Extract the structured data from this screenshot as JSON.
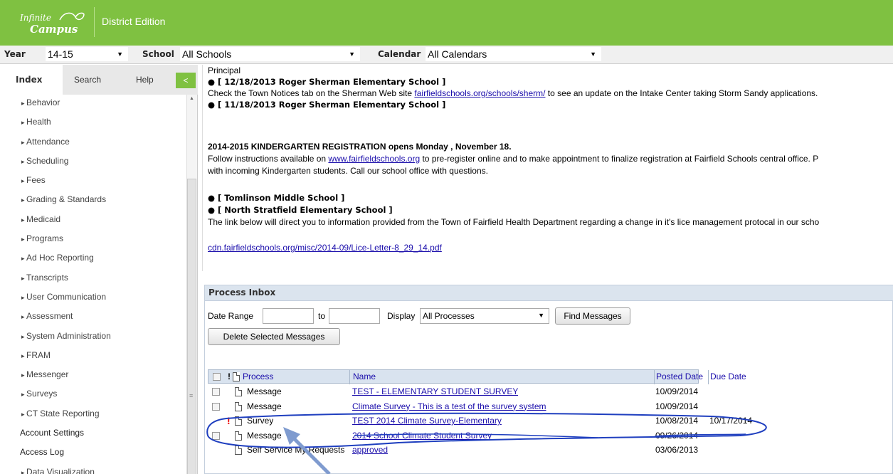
{
  "header": {
    "logo_line1": "Infinite",
    "logo_line2": "Campus",
    "edition": "District Edition",
    "accent_color": "#7fc141"
  },
  "filters": {
    "year_label": "Year",
    "year_value": "14-15",
    "school_label": "School",
    "school_value": "All Schools",
    "calendar_label": "Calendar",
    "calendar_value": "All Calendars"
  },
  "sidebar": {
    "tabs": [
      "Index",
      "Search",
      "Help"
    ],
    "collapse_icon": "chevron-left-icon",
    "items": [
      "Behavior",
      "Health",
      "Attendance",
      "Scheduling",
      "Fees",
      "Grading & Standards",
      "Medicaid",
      "Programs",
      "Ad Hoc Reporting",
      "Transcripts",
      "User Communication",
      "Assessment",
      "System Administration",
      "FRAM",
      "Messenger",
      "Surveys",
      "CT State Reporting",
      "Account Settings",
      "Access Log",
      "Data Visualization"
    ],
    "plain_items": [
      "Account Settings",
      "Access Log"
    ]
  },
  "notices": {
    "l0": "Principal",
    "l1": "[ 12/18/2013 Roger Sherman Elementary School ]",
    "l2_pre": "Check the Town Notices tab on the Sherman Web site ",
    "l2_link": "fairfieldschools.org/schools/sherm/",
    "l2_post": " to see an update on the Intake Center taking Storm Sandy applications.",
    "l3": "[ 11/18/2013 Roger Sherman Elementary School ]",
    "l4": "2014-2015 KINDERGARTEN REGISTRATION opens Monday , November 18.",
    "l5_pre": "Follow instructions available on ",
    "l5_link": "www.fairfieldschools.org",
    "l5_post": " to pre-register online and to make appointment to finalize registration at Fairfield Schools central office.  P",
    "l6": "with incoming Kindergarten students.  Call our school office with questions.",
    "l7": "[ Tomlinson Middle School ]",
    "l8": "[ North Stratfield Elementary School ]",
    "l9": "The link below will direct you to information provided from the Town of Fairfield Health Department regarding a change in it's lice management protocal in our scho",
    "l10": "cdn.fairfieldschools.org/misc/2014-09/Lice-Letter-8_29_14.pdf"
  },
  "inbox": {
    "title": "Process Inbox",
    "date_range_label": "Date Range",
    "to_label": "to",
    "date_from": "",
    "date_to": "",
    "display_label": "Display",
    "display_value": "All Processes",
    "find_button": "Find Messages",
    "delete_button": "Delete Selected Messages",
    "columns": {
      "important": "!",
      "process": "Process",
      "name": "Name",
      "posted": "Posted Date",
      "due": "Due Date"
    },
    "rows": [
      {
        "process": "Message",
        "name": "TEST - ELEMENTARY STUDENT SURVEY",
        "posted": "10/09/2014",
        "due": "",
        "important": "",
        "checkbox": true
      },
      {
        "process": "Message",
        "name": "Climate Survey - This is a test of the survey system",
        "posted": "10/09/2014",
        "due": "",
        "important": "",
        "checkbox": true
      },
      {
        "process": "Survey",
        "name": "TEST 2014 Climate Survey-Elementary",
        "posted": "10/08/2014",
        "due": "10/17/2014",
        "important": "!",
        "checkbox": false
      },
      {
        "process": "Message",
        "name": "2014 School Climate Student Survey",
        "posted": "09/26/2014",
        "due": "",
        "important": "",
        "checkbox": true
      },
      {
        "process": "Self Service My Requests",
        "name": "approved",
        "posted": "03/06/2013",
        "due": "",
        "important": "",
        "checkbox": false
      }
    ]
  }
}
